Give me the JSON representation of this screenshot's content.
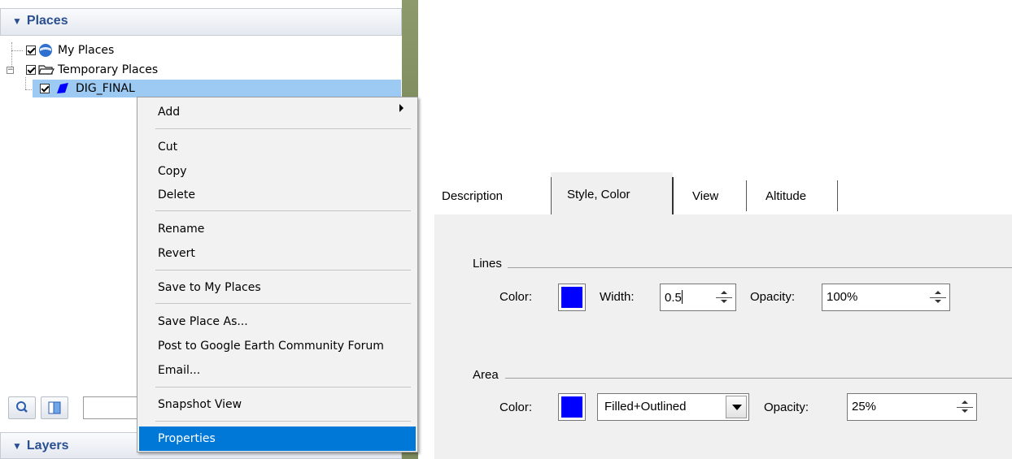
{
  "places_panel": {
    "title": "Places",
    "tree": {
      "my_places": "My Places",
      "temporary_places": "Temporary Places",
      "dig_final": "DIG_FINAL"
    }
  },
  "layers_panel": {
    "title": "Layers"
  },
  "context_menu": {
    "items": {
      "add": "Add",
      "cut": "Cut",
      "copy": "Copy",
      "delete": "Delete",
      "rename": "Rename",
      "revert": "Revert",
      "save_to_my_places": "Save to My Places",
      "save_place_as": "Save Place As...",
      "post_to_forum": "Post to Google Earth Community Forum",
      "email": "Email...",
      "snapshot_view": "Snapshot View",
      "properties": "Properties"
    },
    "highlighted": "Properties"
  },
  "dialog": {
    "tabs": [
      "Description",
      "Style, Color",
      "View",
      "Altitude"
    ],
    "active_tab": "Style, Color",
    "lines": {
      "group_label": "Lines",
      "color_label": "Color:",
      "color": "#0000ff",
      "width_label": "Width:",
      "width_value": "0.5",
      "opacity_label": "Opacity:",
      "opacity_value": "100%"
    },
    "area": {
      "group_label": "Area",
      "color_label": "Color:",
      "color": "#0000ff",
      "fill_mode": "Filled+Outlined",
      "opacity_label": "Opacity:",
      "opacity_value": "25%"
    }
  },
  "colors": {
    "panel_header_text": "#2a4f91",
    "selection_highlight": "#9ccaf3",
    "menu_highlight": "#0078d7"
  }
}
